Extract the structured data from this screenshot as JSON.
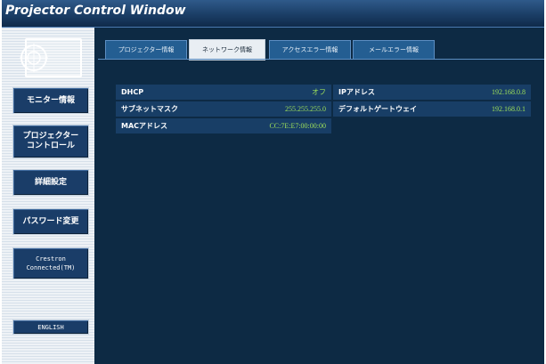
{
  "window": {
    "title": "Projector Control Window"
  },
  "sidebar": {
    "buttons": [
      {
        "label": "モニター情報"
      },
      {
        "label": "プロジェクター\nコントロール"
      },
      {
        "label": "詳細設定"
      },
      {
        "label": "パスワード変更"
      },
      {
        "label": "Crestron\nConnected(TM)"
      },
      {
        "label": "ENGLISH"
      }
    ]
  },
  "tabs": [
    {
      "label": "プロジェクター情報",
      "active": false
    },
    {
      "label": "ネットワーク情報",
      "active": true
    },
    {
      "label": "アクセスエラー情報",
      "active": false
    },
    {
      "label": "メールエラー情報",
      "active": false
    }
  ],
  "network": {
    "dhcp": {
      "label": "DHCP",
      "value": "オフ"
    },
    "ip": {
      "label": "IPアドレス",
      "value": "192.168.0.8"
    },
    "subnet": {
      "label": "サブネットマスク",
      "value": "255.255.255.0"
    },
    "gateway": {
      "label": "デフォルトゲートウェイ",
      "value": "192.168.0.1"
    },
    "mac": {
      "label": "MACアドレス",
      "value": "CC:7E:E7:00:00:00"
    }
  },
  "colors": {
    "background": "#0d2a44",
    "value_text": "#9ee05a",
    "button": "#1a3d68"
  }
}
